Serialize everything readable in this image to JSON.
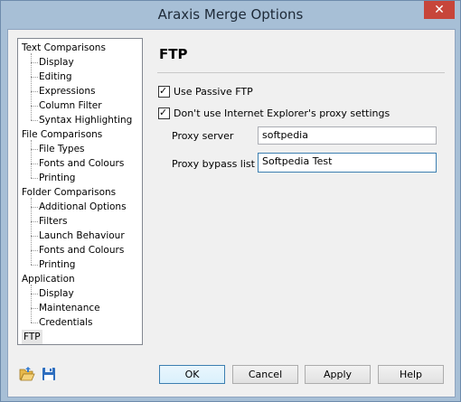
{
  "window": {
    "title": "Araxis Merge Options",
    "close_glyph": "✕"
  },
  "tree": {
    "items": [
      {
        "label": "Text Comparisons",
        "level": 0
      },
      {
        "label": "Display",
        "level": 1
      },
      {
        "label": "Editing",
        "level": 1
      },
      {
        "label": "Expressions",
        "level": 1
      },
      {
        "label": "Column Filter",
        "level": 1
      },
      {
        "label": "Syntax Highlighting",
        "level": 1
      },
      {
        "label": "File Comparisons",
        "level": 0
      },
      {
        "label": "File Types",
        "level": 1
      },
      {
        "label": "Fonts and Colours",
        "level": 1
      },
      {
        "label": "Printing",
        "level": 1
      },
      {
        "label": "Folder Comparisons",
        "level": 0
      },
      {
        "label": "Additional Options",
        "level": 1
      },
      {
        "label": "Filters",
        "level": 1
      },
      {
        "label": "Launch Behaviour",
        "level": 1
      },
      {
        "label": "Fonts and Colours",
        "level": 1
      },
      {
        "label": "Printing",
        "level": 1
      },
      {
        "label": "Application",
        "level": 0
      },
      {
        "label": "Display",
        "level": 1
      },
      {
        "label": "Maintenance",
        "level": 1
      },
      {
        "label": "Credentials",
        "level": 1
      },
      {
        "label": "FTP",
        "level": 0,
        "selected": true
      }
    ]
  },
  "panel": {
    "title": "FTP",
    "use_passive": {
      "label": "Use Passive FTP",
      "checked": true
    },
    "no_ie_proxy": {
      "label": "Don't use Internet Explorer's proxy settings",
      "checked": true
    },
    "proxy_server": {
      "label": "Proxy server",
      "value": "softpedia"
    },
    "proxy_bypass": {
      "label": "Proxy bypass list",
      "value": "Softpedia Test"
    }
  },
  "buttons": {
    "ok": "OK",
    "cancel": "Cancel",
    "apply": "Apply",
    "help": "Help"
  },
  "icons": {
    "open": "folder-open-icon",
    "save": "save-disk-icon"
  },
  "colors": {
    "title_bar": "#a7bfd6",
    "close": "#c7453a",
    "focus": "#3c7fb1"
  }
}
